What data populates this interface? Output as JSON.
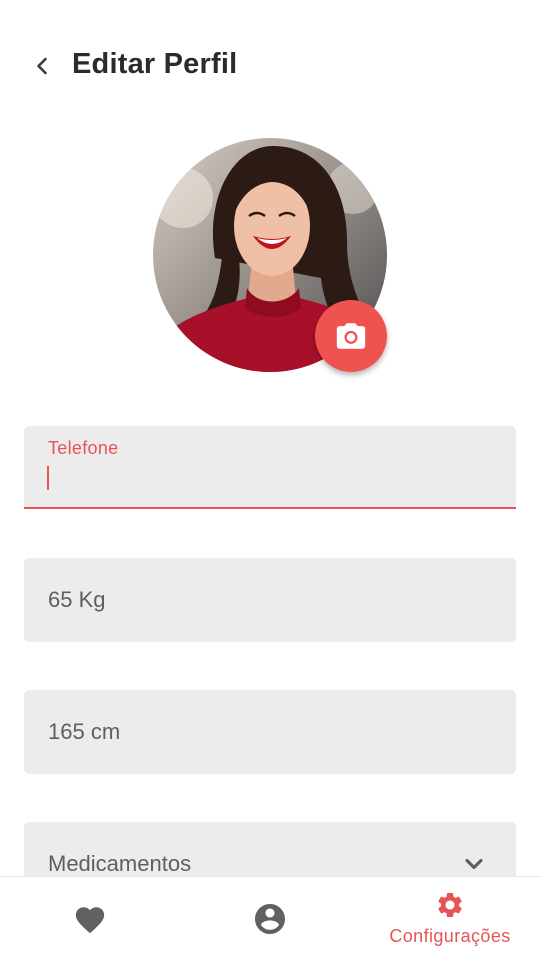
{
  "header": {
    "title": "Editar Perfil"
  },
  "form": {
    "phone": {
      "label": "Telefone",
      "value": ""
    },
    "weight": {
      "value": "65 Kg"
    },
    "height": {
      "value": "165 cm"
    },
    "medications": {
      "value": "Medicamentos"
    }
  },
  "bottom_nav": {
    "items": [
      {
        "icon": "heart-icon"
      },
      {
        "icon": "account-circle-icon"
      },
      {
        "icon": "gear-icon",
        "label": "Configurações",
        "active": true
      }
    ]
  },
  "colors": {
    "accent": "#e85456",
    "field_bg": "#ececec",
    "inactive_icon": "#616161"
  }
}
